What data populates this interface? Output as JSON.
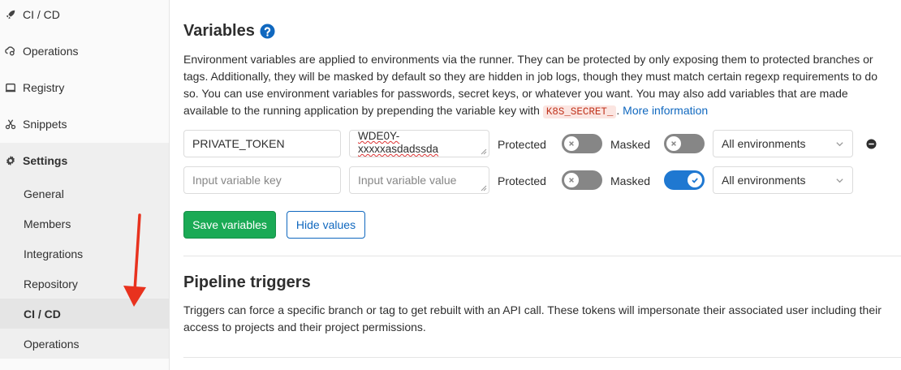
{
  "sidebar": {
    "items": [
      {
        "label": "CI / CD",
        "icon": "rocket-icon"
      },
      {
        "label": "Operations",
        "icon": "cloud-gear-icon"
      },
      {
        "label": "Registry",
        "icon": "container-icon"
      },
      {
        "label": "Snippets",
        "icon": "scissors-icon"
      },
      {
        "label": "Settings",
        "icon": "gear-icon"
      }
    ],
    "settings_sub": [
      {
        "label": "General"
      },
      {
        "label": "Members"
      },
      {
        "label": "Integrations"
      },
      {
        "label": "Repository"
      },
      {
        "label": "CI / CD",
        "active": true
      },
      {
        "label": "Operations"
      }
    ]
  },
  "variables": {
    "title": "Variables",
    "description_pre": "Environment variables are applied to environments via the runner. They can be protected by only exposing them to protected branches or tags. Additionally, they will be masked by default so they are hidden in job logs, though they must match certain regexp requirements to do so. You can use environment variables for passwords, secret keys, or whatever you want. You may also add variables that are made available to the running application by prepending the variable key with ",
    "code": "K8S_SECRET_",
    "description_post": ". ",
    "more_link": "More information",
    "rows": [
      {
        "key": "PRIVATE_TOKEN",
        "value_line1": "WDE0Y-",
        "value_line2": "xxxxxasdadssda",
        "protected_label": "Protected",
        "protected": false,
        "masked_label": "Masked",
        "masked": false,
        "environment": "All environments"
      },
      {
        "key_placeholder": "Input variable key",
        "value_placeholder": "Input variable value",
        "protected_label": "Protected",
        "protected": false,
        "masked_label": "Masked",
        "masked": true,
        "environment": "All environments"
      }
    ],
    "save_label": "Save variables",
    "hide_label": "Hide values"
  },
  "pipeline": {
    "title": "Pipeline triggers",
    "description": "Triggers can force a specific branch or tag to get rebuilt with an API call. These tokens will impersonate their associated user including their access to projects and their project permissions."
  },
  "colors": {
    "save_green": "#1aaa55",
    "link_blue": "#1068bf",
    "toggle_on": "#1f78d1",
    "toggle_off": "#868686",
    "arrow_red": "#e8321e"
  }
}
